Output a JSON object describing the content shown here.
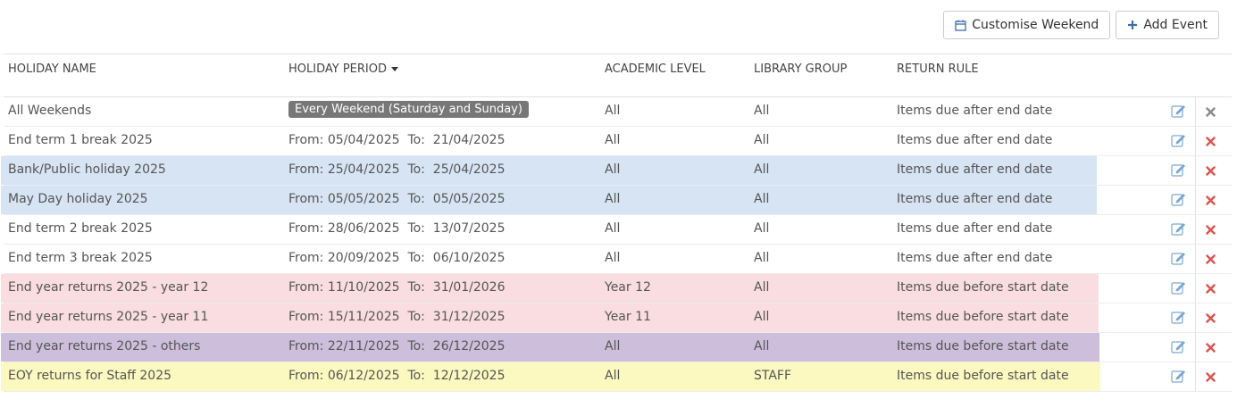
{
  "toolbar": {
    "customise_label": "Customise Weekend",
    "add_label": "Add Event"
  },
  "table": {
    "headers": {
      "name": "HOLIDAY NAME",
      "period": "HOLIDAY PERIOD",
      "level": "ACADEMIC LEVEL",
      "group": "LIBRARY GROUP",
      "rule": "RETURN RULE"
    },
    "rows": [
      {
        "name": "All Weekends",
        "period": "Every Weekend (Saturday and Sunday)",
        "level": "All",
        "group": "All",
        "rule": "Items due after end date",
        "highlight": "",
        "del_color": "#888888"
      },
      {
        "name": "End term 1 break 2025",
        "period": "From: 05/04/2025  To:  21/04/2025",
        "level": "All",
        "group": "All",
        "rule": "Items due after end date",
        "highlight": "",
        "del_color": "#d9534f"
      },
      {
        "name": "Bank/Public holiday 2025",
        "period": "From: 25/04/2025  To:  25/04/2025",
        "level": "All",
        "group": "All",
        "rule": "Items due after end date",
        "highlight": "#d6e4f4",
        "del_color": "#d9534f"
      },
      {
        "name": "May Day holiday 2025",
        "period": "From: 05/05/2025  To:  05/05/2025",
        "level": "All",
        "group": "All",
        "rule": "Items due after end date",
        "highlight": "#d6e4f4",
        "del_color": "#d9534f"
      },
      {
        "name": "End term 2 break 2025",
        "period": "From: 28/06/2025  To:  13/07/2025",
        "level": "All",
        "group": "All",
        "rule": "Items due after end date",
        "highlight": "",
        "del_color": "#d9534f"
      },
      {
        "name": "End term 3 break 2025",
        "period": "From: 20/09/2025  To:  06/10/2025",
        "level": "All",
        "group": "All",
        "rule": "Items due after end date",
        "highlight": "",
        "del_color": "#d9534f"
      },
      {
        "name": "End year returns 2025 - year 12",
        "period": "From: 11/10/2025  To:  31/01/2026",
        "level": "Year 12",
        "group": "All",
        "rule": "Items due before start date",
        "highlight": "#f9dde0",
        "del_color": "#d9534f"
      },
      {
        "name": "End year returns 2025 - year 11",
        "period": "From: 15/11/2025  To:  31/12/2025",
        "level": "Year 11",
        "group": "All",
        "rule": "Items due before start date",
        "highlight": "#f9dde0",
        "del_color": "#d9534f"
      },
      {
        "name": "End year returns 2025 - others",
        "period": "From: 22/11/2025  To:  26/12/2025",
        "level": "All",
        "group": "All",
        "rule": "Items due before start date",
        "highlight": "#cdbfdb",
        "del_color": "#d9534f"
      },
      {
        "name": "EOY returns for Staff 2025",
        "period": "From: 06/12/2025  To:  12/12/2025",
        "level": "All",
        "group": "STAFF",
        "rule": "Items due before start date",
        "highlight": "#fbf8c0",
        "del_color": "#d9534f"
      }
    ]
  },
  "icons": {
    "edit": "edit-icon",
    "delete": "delete-icon",
    "calendar": "calendar-icon",
    "plus": "plus-icon",
    "edit_color": "#7aa6d2"
  }
}
